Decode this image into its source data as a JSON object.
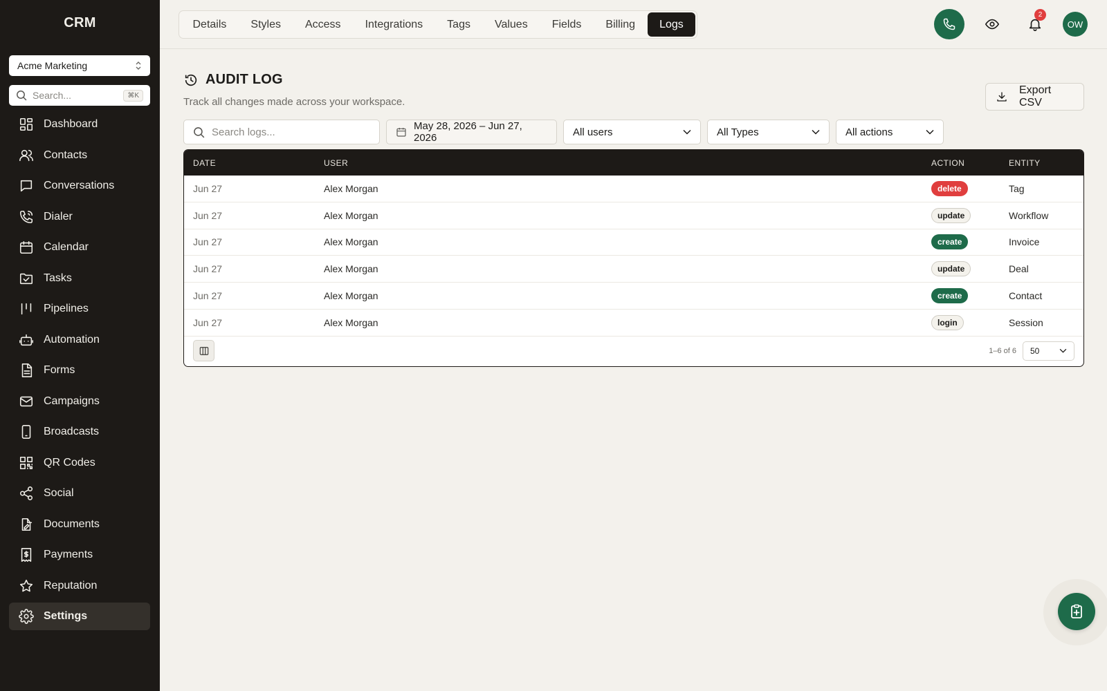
{
  "sidebar": {
    "brand": "CRM",
    "workspace": "Acme Marketing",
    "search_placeholder": "Search...",
    "search_shortcut": "⌘K",
    "items": [
      {
        "label": "Dashboard",
        "icon": "dashboard-icon"
      },
      {
        "label": "Contacts",
        "icon": "contacts-icon"
      },
      {
        "label": "Conversations",
        "icon": "chat-icon"
      },
      {
        "label": "Dialer",
        "icon": "phone-icon"
      },
      {
        "label": "Calendar",
        "icon": "calendar-icon"
      },
      {
        "label": "Tasks",
        "icon": "folder-check-icon"
      },
      {
        "label": "Pipelines",
        "icon": "pipeline-icon"
      },
      {
        "label": "Automation",
        "icon": "bot-icon"
      },
      {
        "label": "Forms",
        "icon": "form-icon"
      },
      {
        "label": "Campaigns",
        "icon": "mail-icon"
      },
      {
        "label": "Broadcasts",
        "icon": "mobile-icon"
      },
      {
        "label": "QR Codes",
        "icon": "qr-icon"
      },
      {
        "label": "Social",
        "icon": "share-icon"
      },
      {
        "label": "Documents",
        "icon": "document-edit-icon"
      },
      {
        "label": "Payments",
        "icon": "dollar-receipt-icon"
      },
      {
        "label": "Reputation",
        "icon": "star-icon"
      },
      {
        "label": "Settings",
        "icon": "gear-icon",
        "active": true
      }
    ]
  },
  "tabs": [
    {
      "label": "Details"
    },
    {
      "label": "Styles"
    },
    {
      "label": "Access"
    },
    {
      "label": "Integrations"
    },
    {
      "label": "Tags"
    },
    {
      "label": "Values"
    },
    {
      "label": "Fields"
    },
    {
      "label": "Billing"
    },
    {
      "label": "Logs",
      "active": true
    }
  ],
  "header": {
    "notification_count": "2",
    "avatar_initials": "OW"
  },
  "page": {
    "title": "AUDIT LOG",
    "subtitle": "Track all changes made across your workspace.",
    "export_label": "Export CSV"
  },
  "filters": {
    "search_placeholder": "Search logs...",
    "date_range": "May 28, 2026 – Jun 27, 2026",
    "users": "All users",
    "types": "All Types",
    "actions": "All actions"
  },
  "table": {
    "columns": {
      "date": "DATE",
      "user": "USER",
      "action": "ACTION",
      "entity": "ENTITY"
    },
    "rows": [
      {
        "date": "Jun 27",
        "user": "Alex Morgan",
        "action": "delete",
        "entity": "Tag"
      },
      {
        "date": "Jun 27",
        "user": "Alex Morgan",
        "action": "update",
        "entity": "Workflow"
      },
      {
        "date": "Jun 27",
        "user": "Alex Morgan",
        "action": "create",
        "entity": "Invoice"
      },
      {
        "date": "Jun 27",
        "user": "Alex Morgan",
        "action": "update",
        "entity": "Deal"
      },
      {
        "date": "Jun 27",
        "user": "Alex Morgan",
        "action": "create",
        "entity": "Contact"
      },
      {
        "date": "Jun 27",
        "user": "Alex Morgan",
        "action": "login",
        "entity": "Session"
      }
    ],
    "pagination": "1–6 of 6",
    "per_page": "50"
  },
  "colors": {
    "sidebar_bg": "#1d1a17",
    "accent_green": "#1e6b4a",
    "danger_red": "#e03e3e",
    "page_bg": "#f3f1ec"
  }
}
